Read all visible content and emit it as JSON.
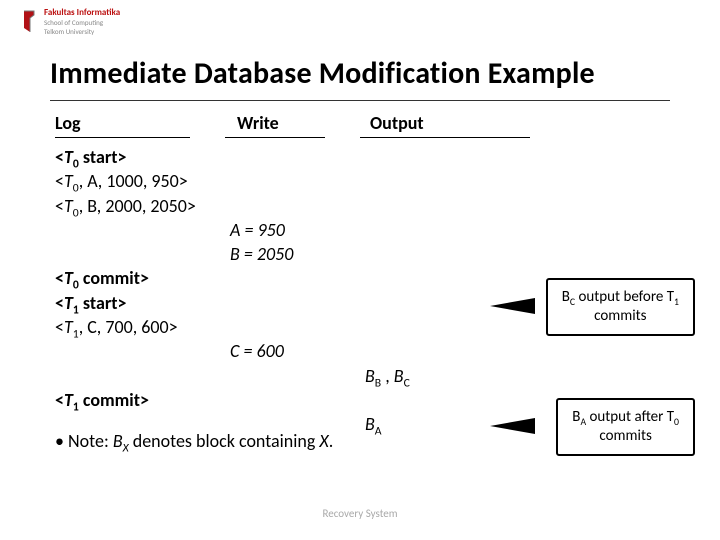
{
  "logo": {
    "name": "Fakultas Informatika",
    "sub1": "School of Computing",
    "sub2": "Telkom University",
    "brand_color": "#b11116"
  },
  "title": "Immediate Database Modification Example",
  "headers": {
    "log": "Log",
    "write": "Write",
    "output": "Output"
  },
  "log": {
    "l1a": "<",
    "l1b": "T",
    "l1c": "0",
    "l1d": " start>",
    "l2a": "<",
    "l2b": "T",
    "l2c": "0",
    "l2d": ", A, 1000, 950>",
    "l3a": "<",
    "l3b": "T",
    "l3c": "0",
    "l3d": ", B, 2000, 2050>",
    "w1": "A = 950",
    "w2": "B = 2050",
    "l4a": "<",
    "l4b": "T",
    "l4c": "0",
    "l4d": " commit>",
    "l5a": "<",
    "l5b": "T",
    "l5c": "1",
    "l5d": " start>",
    "l6a": "<",
    "l6b": "T",
    "l6c": "1",
    "l6d": ", C, 700, 600>",
    "w3": "C = 600",
    "o1a": "B",
    "o1b": "B",
    "o1c": " , ",
    "o1d": "B",
    "o1e": "C",
    "l7a": "<",
    "l7b": "T",
    "l7c": "1",
    "l7d": " commit>",
    "o2a": "B",
    "o2b": "A"
  },
  "note": {
    "bullet": "• Note: ",
    "b1": "B",
    "bx": "X",
    "rest": " denotes block containing ",
    "x": "X",
    "end": "."
  },
  "callouts": {
    "c1a": "B",
    "c1b": "C",
    "c1c": " output before T",
    "c1d": "1",
    "c1e": "commits",
    "c2a": "B",
    "c2b": "A",
    "c2c": " output after T",
    "c2d": "0",
    "c2e": "commits"
  },
  "footer": "Recovery System"
}
